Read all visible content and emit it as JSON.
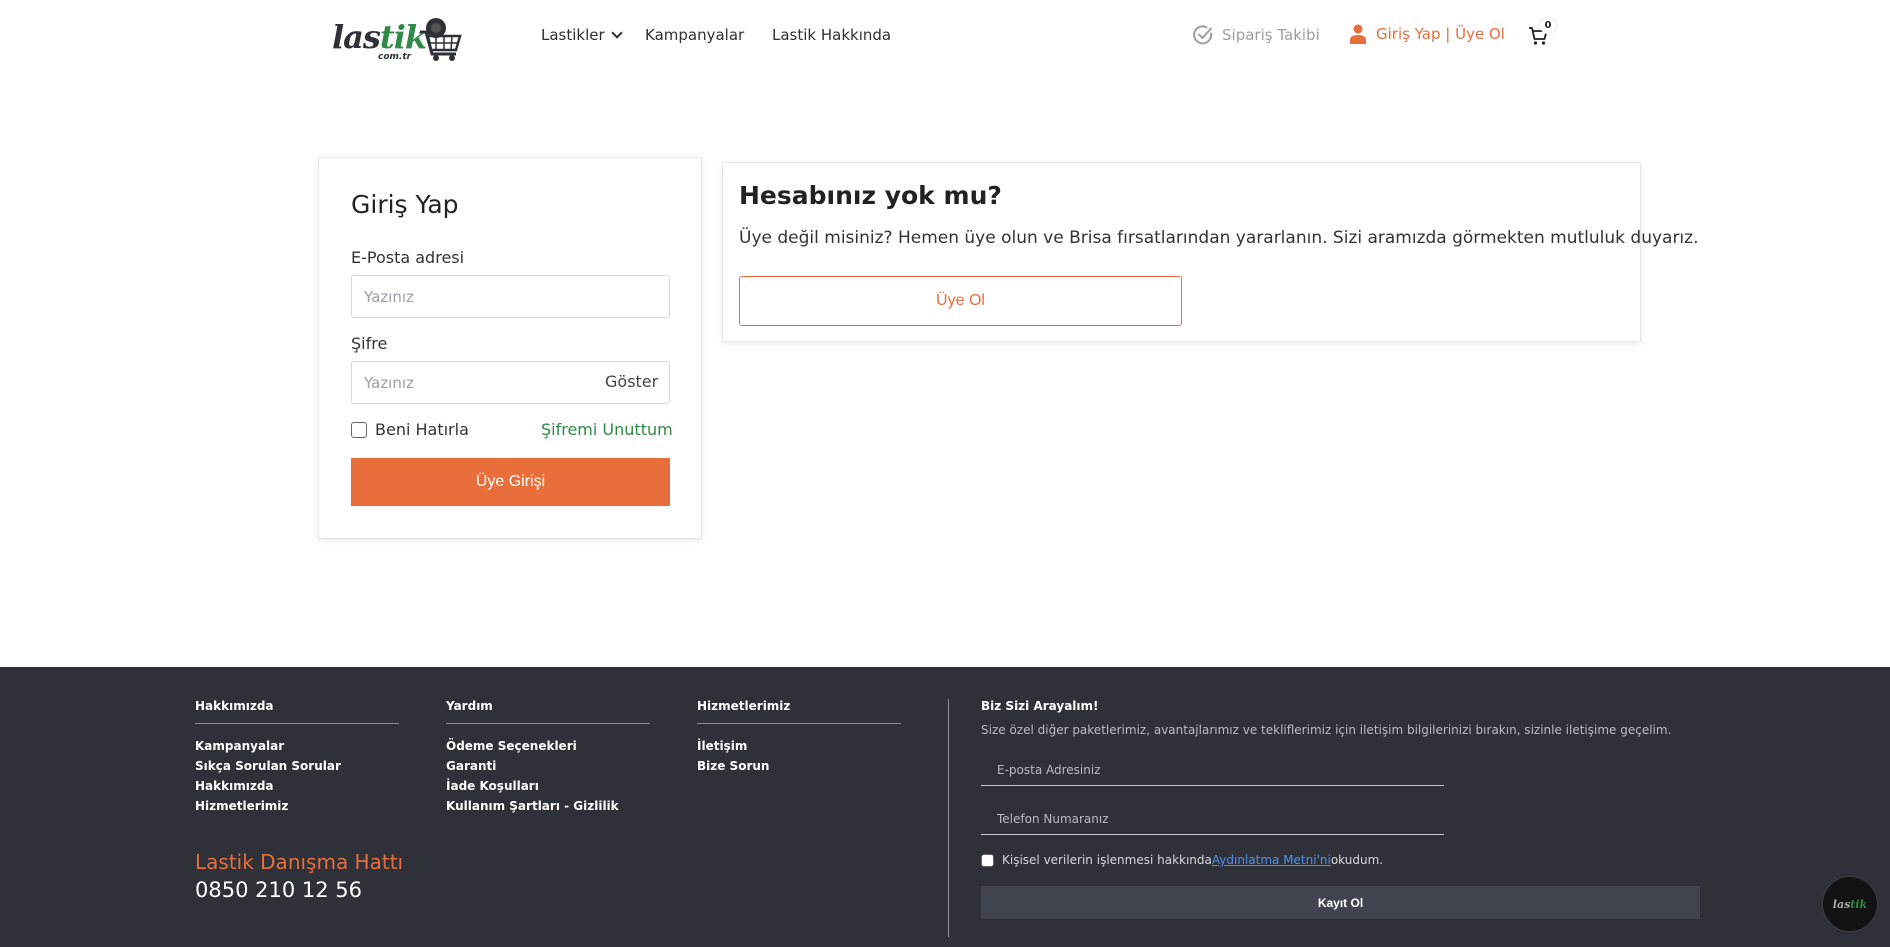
{
  "header": {
    "logo": {
      "text_a": "las",
      "text_b": "tik",
      "sub": "com.tr"
    },
    "nav": [
      {
        "label": "Lastikler",
        "has_dropdown": true
      },
      {
        "label": "Kampanyalar"
      },
      {
        "label": "Lastik Hakkında"
      }
    ],
    "order_tracking": "Sipariş Takibi",
    "login_register": "Giriş Yap | Üye Ol",
    "cart_count": "0"
  },
  "login": {
    "title": "Giriş Yap",
    "email_label": "E-Posta adresi",
    "email_placeholder": "Yazınız",
    "password_label": "Şifre",
    "password_placeholder": "Yazınız",
    "show_label": "Göster",
    "remember_label": "Beni Hatırla",
    "forgot_label": "Şifremi Unuttum",
    "submit_label": "Üye Girişi"
  },
  "register": {
    "title": "Hesabınız yok mu?",
    "text": "Üye değil misiniz? Hemen üye olun ve Brisa fırsatlarından yararlanın. Sizi aramızda görmekten mutluluk duyarız.",
    "button_label": "Üye Ol"
  },
  "footer": {
    "columns": [
      {
        "title": "Hakkımızda",
        "links": [
          "Kampanyalar",
          "Sıkça Sorulan Sorular",
          "Hakkımızda",
          "Hizmetlerimiz"
        ]
      },
      {
        "title": "Yardım",
        "links": [
          "Ödeme Seçenekleri",
          "Garanti",
          "İade Koşulları",
          "Kullanım Şartları - Gizlilik"
        ]
      },
      {
        "title": "Hizmetlerimiz",
        "links": [
          "İletişim",
          "Bize Sorun"
        ]
      }
    ],
    "hotline_title": "Lastik Danışma Hattı",
    "hotline_number": "0850 210 12 56",
    "callus": {
      "title": "Biz Sizi Arayalım!",
      "description": "Size özel diğer paketlerimiz, avantajlarımız ve tekliflerimiz için iletişim bilgilerinizi bırakın, sizinle iletişime geçelim.",
      "email_placeholder": "E-posta Adresiniz",
      "phone_placeholder": "Telefon Numaranız",
      "consent_prefix": "Kişisel verilerin işlenmesi hakkında",
      "consent_link": "Aydınlatma Metni'ni",
      "consent_suffix": "okudum.",
      "submit_label": "Kayıt Ol"
    }
  },
  "chat_widget": {
    "text_a": "las",
    "text_b": "tik"
  },
  "colors": {
    "accent": "#e86e3b",
    "green": "#2f8a47",
    "footer_bg": "#2e3138",
    "link_blue": "#4f8ff0"
  }
}
